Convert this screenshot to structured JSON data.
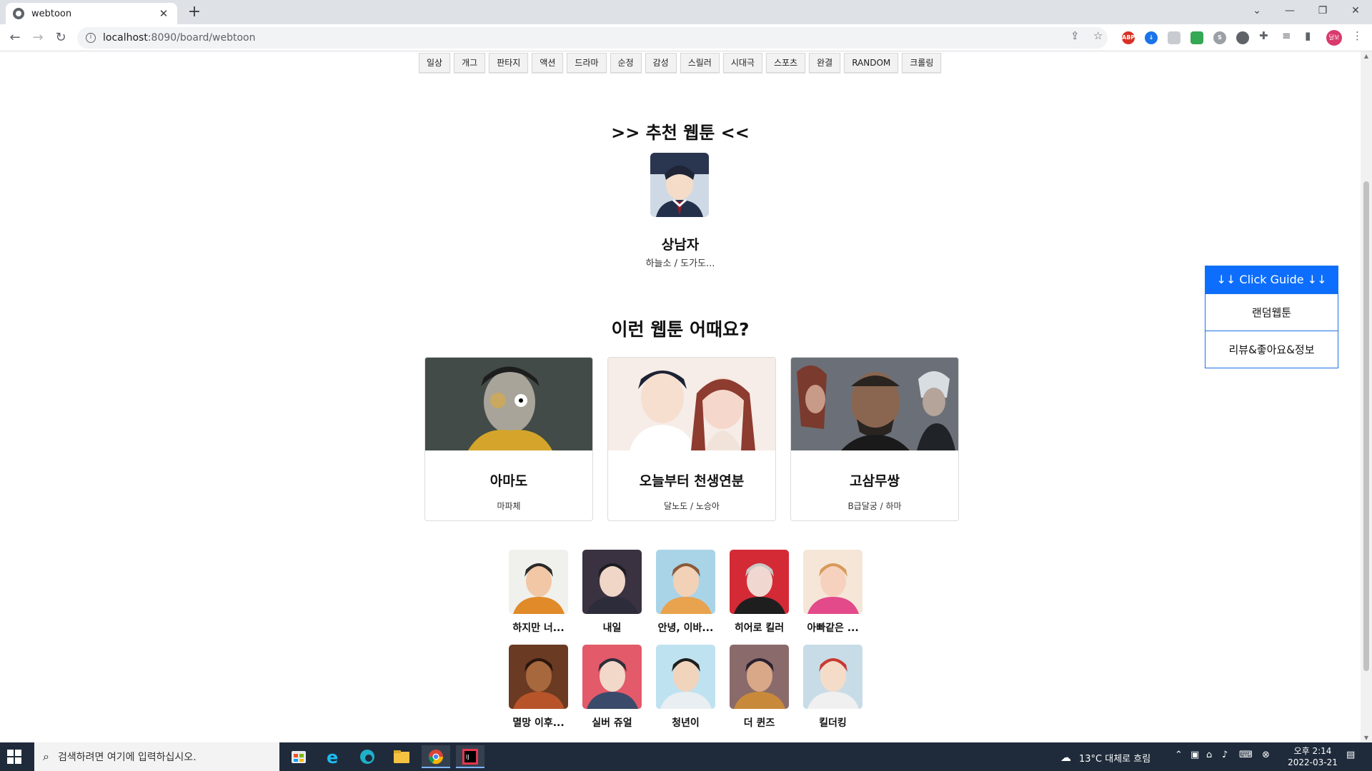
{
  "browser": {
    "tab_title": "webtoon",
    "tab_close": "✕",
    "new_tab": "+",
    "url_host": "localhost",
    "url_path": ":8090/board/webtoon",
    "profile_initials": "달보"
  },
  "genres": [
    "일상",
    "개그",
    "판타지",
    "액션",
    "드라마",
    "순정",
    "감성",
    "스릴러",
    "시대극",
    "스포츠",
    "완결",
    "RANDOM",
    "크롤링"
  ],
  "recommended": {
    "heading": ">> 추천 웹툰 <<",
    "name": "상남자",
    "authors": "하늘소 / 도가도..."
  },
  "suggestions": {
    "heading": "이런 웹툰 어때요?",
    "cards": [
      {
        "name": "아마도",
        "authors": "마파체"
      },
      {
        "name": "오늘부터 천생연분",
        "authors": "달노도 / 노승아"
      },
      {
        "name": "고삼무쌍",
        "authors": "B급달궁 / 하마"
      }
    ]
  },
  "grid": [
    "하지만 너...",
    "내일",
    "안녕, 이바...",
    "히어로 킬러",
    "아빠같은 ...",
    "멸망 이후...",
    "실버 쥬얼",
    "청년이",
    "더 퀸즈",
    "킬더킹"
  ],
  "guide": {
    "head": "↓↓ Click Guide ↓↓",
    "option1": "랜덤웹툰",
    "option2": "리뷰&좋아요&정보"
  },
  "taskbar": {
    "search_placeholder": "검색하려면 여기에 입력하십시오.",
    "weather": "13°C  대체로 흐림",
    "time": "오후 2:14",
    "date": "2022-03-21"
  },
  "colors": {
    "guide_blue": "#0d6efd",
    "taskbar": "#1f2b3b"
  }
}
